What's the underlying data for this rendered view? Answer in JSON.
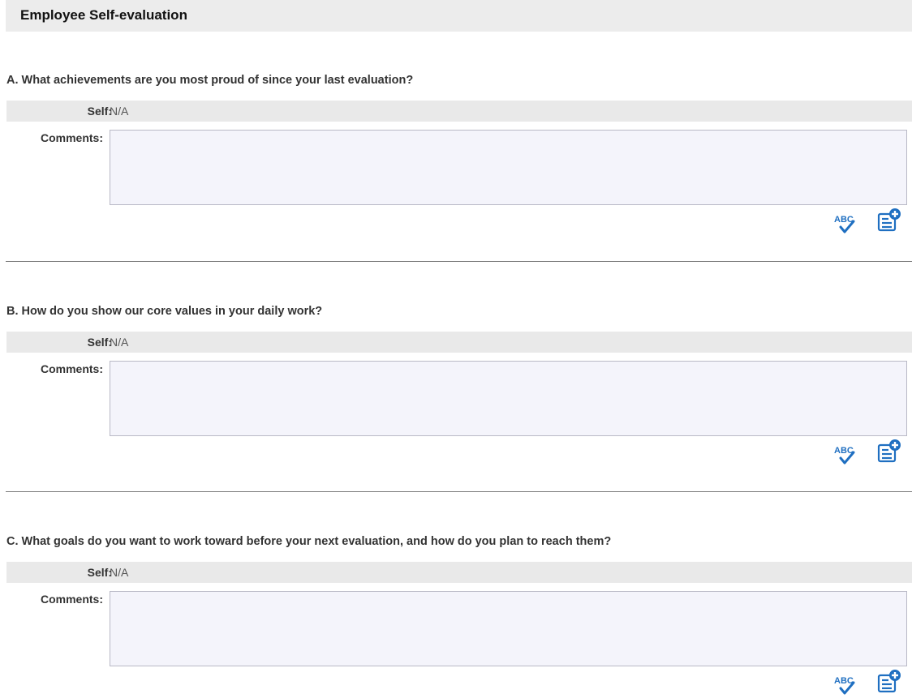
{
  "section": {
    "title": "Employee Self-evaluation"
  },
  "questions": [
    {
      "title": "A. What achievements are you most proud of since your last evaluation?",
      "self_label": "Self:",
      "self_value": "N/A",
      "comments_label": "Comments:",
      "comments_value": ""
    },
    {
      "title": "B. How do you show our core values in your daily work?",
      "self_label": "Self:",
      "self_value": "N/A",
      "comments_label": "Comments:",
      "comments_value": ""
    },
    {
      "title": "C. What goals do you want to work toward before your next evaluation, and how do you plan to reach them?",
      "self_label": "Self:",
      "self_value": "N/A",
      "comments_label": "Comments:",
      "comments_value": ""
    }
  ],
  "icons": {
    "spellcheck": "spellcheck-icon",
    "add_note": "add-note-icon",
    "spellcheck_text": "ABC"
  },
  "colors": {
    "accent": "#1f6fc1",
    "header_bg": "#ececec",
    "self_row_bg": "#e9e9e9",
    "comments_bg": "#f4f4fb"
  }
}
